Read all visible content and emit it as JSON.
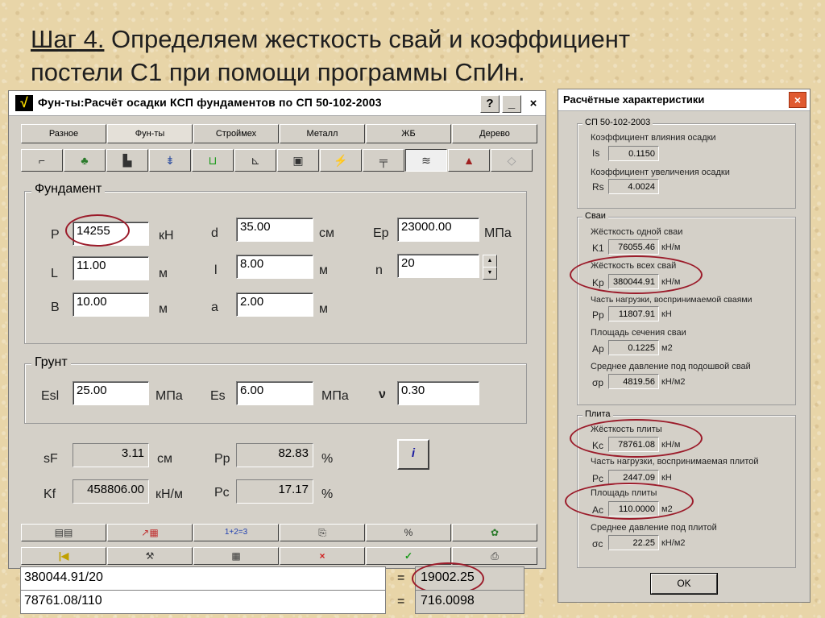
{
  "slide": {
    "step": "Шаг 4.",
    "title_rest": " Определяем жесткость свай и коэффициент",
    "title_line2": "постели С1 при помощи программы СпИн."
  },
  "window": {
    "app_icon": "√",
    "title": "Фун-ты:Расчёт осадки КСП фундаментов по СП 50-102-2003",
    "help": "?",
    "minimize": "_",
    "close": "×",
    "tabs": [
      "Разное",
      "Фун-ты",
      "Строймех",
      "Металл",
      "ЖБ",
      "Дерево"
    ],
    "active_tab": "Фун-ты",
    "tools": [
      "⌐",
      "♣",
      "▙",
      "⇟",
      "⊔",
      "⊾",
      "▣",
      "⚡",
      "╤",
      "≋",
      "▲",
      "◇"
    ]
  },
  "foundation": {
    "label": "Фундамент",
    "P": {
      "label": "P",
      "value": "14255",
      "unit": "кН"
    },
    "L": {
      "label": "L",
      "value": "11.00",
      "unit": "м"
    },
    "B": {
      "label": "B",
      "value": "10.00",
      "unit": "м"
    },
    "d": {
      "label": "d",
      "value": "35.00",
      "unit": "см"
    },
    "l": {
      "label": "l",
      "value": "8.00",
      "unit": "м"
    },
    "a": {
      "label": "a",
      "value": "2.00",
      "unit": "м"
    },
    "Ep": {
      "label": "Ep",
      "value": "23000.00",
      "unit": "МПа"
    },
    "n": {
      "label": "n",
      "value": "20"
    }
  },
  "soil": {
    "label": "Грунт",
    "Esl": {
      "label": "Esl",
      "value": "25.00",
      "unit": "МПа"
    },
    "Es": {
      "label": "Es",
      "value": "6.00",
      "unit": "МПа"
    },
    "nu": {
      "label": "ν",
      "value": "0.30"
    }
  },
  "results": {
    "sF": {
      "label": "sF",
      "value": "3.11",
      "unit": "см"
    },
    "Kf": {
      "label": "Kf",
      "value": "458806.00",
      "unit": "кН/м"
    },
    "Pp": {
      "label": "Pp",
      "value": "82.83",
      "unit": "%"
    },
    "Pc": {
      "label": "Pc",
      "value": "17.17",
      "unit": "%"
    },
    "info_button": "i"
  },
  "bottom_bar1": [
    "▤▤",
    "↗▦",
    "1+2=3",
    "⎘",
    "%",
    "✿"
  ],
  "bottom_bar2": [
    "|◀",
    "⚒",
    "▦",
    "×",
    "✓",
    "⎙"
  ],
  "calc": [
    {
      "expr": "380044.91/20",
      "eq": "=",
      "result": "19002.25"
    },
    {
      "expr": "78761.08/110",
      "eq": "=",
      "result": "716.0098"
    }
  ],
  "dialog": {
    "title": "Расчётные характеристики",
    "close": "×",
    "sp": {
      "label": "СП 50-102-2003",
      "rows": [
        {
          "desc": "Коэффициент влияния осадки",
          "sym": "Is",
          "value": "0.1150",
          "unit": ""
        },
        {
          "desc": "Коэффициент увеличения осадки",
          "sym": "Rs",
          "value": "4.0024",
          "unit": ""
        }
      ]
    },
    "piles": {
      "label": "Сваи",
      "rows": [
        {
          "desc": "Жёсткость одной сваи",
          "sym": "K1",
          "value": "76055.46",
          "unit": "кН/м"
        },
        {
          "desc": "Жёсткость всех свай",
          "sym": "Kp",
          "value": "380044.91",
          "unit": "кН/м"
        },
        {
          "desc": "Часть нагрузки, воспринимаемой сваями",
          "sym": "Pp",
          "value": "11807.91",
          "unit": "кН"
        },
        {
          "desc": "Площадь сечения сваи",
          "sym": "Ap",
          "value": "0.1225",
          "unit": "м2"
        },
        {
          "desc": "Среднее давление под подошвой свай",
          "sym": "σp",
          "value": "4819.56",
          "unit": "кН/м2"
        }
      ]
    },
    "slab": {
      "label": "Плита",
      "rows": [
        {
          "desc": "Жёсткость плиты",
          "sym": "Kc",
          "value": "78761.08",
          "unit": "кН/м"
        },
        {
          "desc": "Часть нагрузки, воспринимаемая плитой",
          "sym": "Pc",
          "value": "2447.09",
          "unit": "кН"
        },
        {
          "desc": "Площадь плиты",
          "sym": "Ac",
          "value": "110.0000",
          "unit": "м2"
        },
        {
          "desc": "Среднее давление под плитой",
          "sym": "σc",
          "value": "22.25",
          "unit": "кН/м2"
        }
      ]
    },
    "ok": "OK"
  }
}
